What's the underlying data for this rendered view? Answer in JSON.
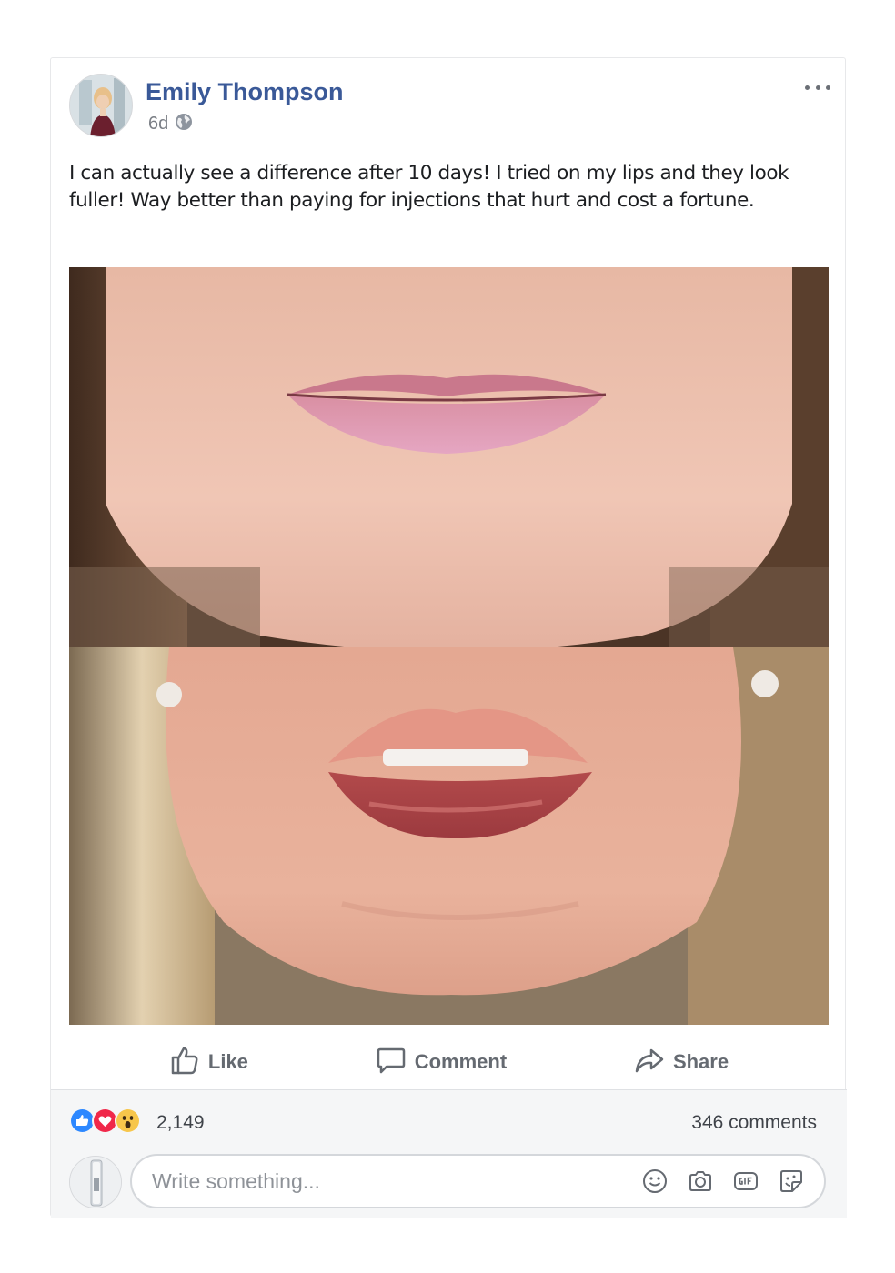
{
  "post": {
    "author": "Emily Thompson",
    "time": "6d",
    "privacy_icon": "globe-icon",
    "text": "I can actually see a difference after 10 days! I tried on my lips and they look fuller! Way better than paying for injections that hurt and cost a fortune."
  },
  "actions": {
    "like_label": "Like",
    "comment_label": "Comment",
    "share_label": "Share"
  },
  "stats": {
    "reactions": [
      "like-reaction-icon",
      "love-reaction-icon",
      "wow-reaction-icon"
    ],
    "reaction_count": "2,149",
    "comments_count": "346 comments"
  },
  "composer": {
    "placeholder": "Write something...",
    "tools": [
      "emoji-icon",
      "camera-icon",
      "gif-icon",
      "sticker-icon"
    ]
  },
  "colors": {
    "author_link": "#3a5998",
    "like_blue": "#2d88ff",
    "love_red": "#f0284a",
    "wow_yellow": "#f7c64b"
  }
}
